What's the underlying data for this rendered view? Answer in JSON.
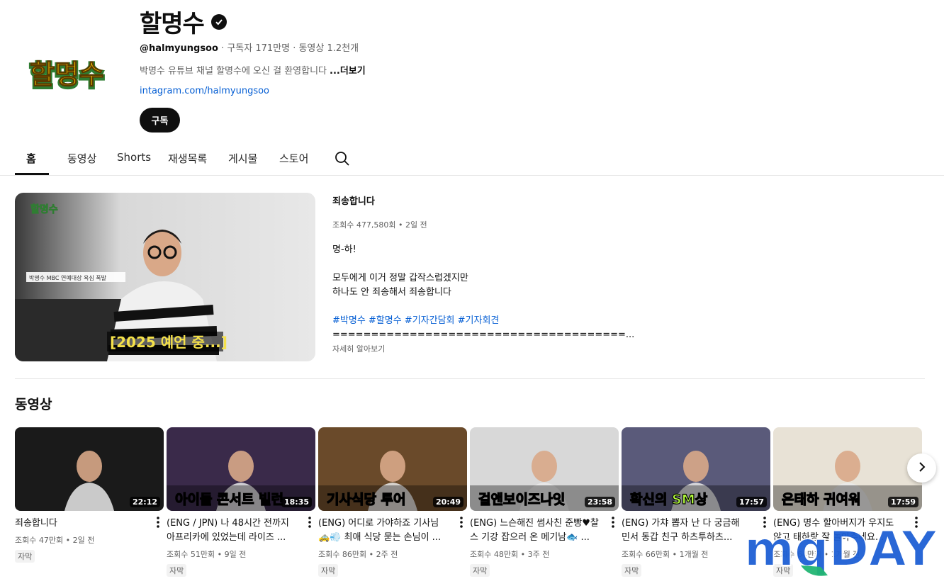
{
  "channel": {
    "name": "할명수",
    "logo_text": "할명수",
    "handle": "@halmyungsoo",
    "stats": " · 구독자 171만명 · 동영상 1.2천개",
    "description": "박명수 유튜브 채널 할명수에 오신 걸 환영합니다",
    "more_label": "...더보기",
    "link": "intagram.com/halmyungsoo",
    "subscribe_label": "구독"
  },
  "tabs": [
    {
      "label": "홈",
      "active": true
    },
    {
      "label": "동영상"
    },
    {
      "label": "Shorts"
    },
    {
      "label": "재생목록"
    },
    {
      "label": "게시물"
    },
    {
      "label": "스토어"
    }
  ],
  "featured": {
    "title": "죄송합니다",
    "meta": "조회수 477,580회 • 2일 전",
    "thumb_logo": "할명수",
    "thumb_caption": "[2025 예언 중...]",
    "thumb_lower": "박명수 MBC 연예대상 욕심 폭발",
    "desc_lines": [
      "명-하!",
      "",
      "모두에게 이거 정말 갑작스럽겠지만",
      "하나도 안 죄송해서 죄송합니다",
      "",
      "#박명수 #할명수 #기자간담회 #기자회견",
      "======================================..."
    ],
    "more_label": "자세히 알아보기"
  },
  "shelf": {
    "title": "동영상",
    "videos": [
      {
        "title_lines": [
          "죄송합니다"
        ],
        "duration": "22:12",
        "meta": "조회수 47만회 • 2일 전",
        "badge": "자막",
        "overlay": "",
        "bg": "#1a1a1a"
      },
      {
        "title_lines": [
          "(ENG / JPN) 나 48시간 전까지",
          "아프리카에 있었는데 라이즈 ..."
        ],
        "duration": "18:35",
        "meta": "조회수 51만회 • 9일 전",
        "badge": "자막",
        "overlay": "아이돌 콘서트 빌런",
        "bg": "#3a2a4a"
      },
      {
        "title_lines": [
          "(ENG) 어디로 가야하죠 기사님",
          "🚕💨 최애 식당 묻는 손님이 ..."
        ],
        "duration": "20:49",
        "meta": "조회수 86만회 • 2주 전",
        "badge": "자막",
        "overlay": "기사식당 투어",
        "bg": "#6a4a2a"
      },
      {
        "title_lines": [
          "(ENG) 느슨해진 썸사친 준빵♥찰",
          "스 기강 잡으러 온 메기남🐟 ..."
        ],
        "duration": "23:58",
        "meta": "조회수 48만회 • 3주 전",
        "badge": "자막",
        "overlay": "걸앤보이즈나잇",
        "bg": "#d8d8d8"
      },
      {
        "title_lines": [
          "(ENG) 가챠 뽑자 난 다 궁금해",
          "민서 동갑 친구 하츠투하츠..."
        ],
        "duration": "17:57",
        "meta": "조회수 66만회 • 1개월 전",
        "badge": "자막",
        "overlay": "확신의 SM상",
        "bg": "#5a5a7a"
      },
      {
        "title_lines": [
          "(ENG) 명수 할아버지가 우지도",
          "않고 태하랑 잘 놀아주네요..."
        ],
        "duration": "17:59",
        "meta": "조회수 64만회 • 1개월 전",
        "badge": "자막",
        "overlay": "은태하 귀여워",
        "bg": "#e8e2d6"
      }
    ]
  },
  "watermark_text": "mqDAY",
  "colors": {
    "accent": "#0f0f0f",
    "link": "#065fd4",
    "logo_yellow": "#f5c400",
    "logo_green": "#2f7d32",
    "watermark_blue": "#1e5fd4",
    "watermark_green": "#22b573"
  }
}
